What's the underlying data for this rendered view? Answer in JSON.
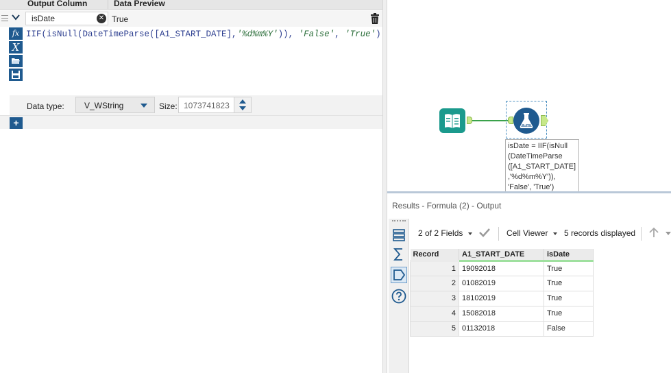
{
  "formula_panel": {
    "header": {
      "output_column": "Output Column",
      "data_preview": "Data Preview"
    },
    "field": {
      "name": "isDate",
      "preview": "True"
    },
    "expression": {
      "parts": [
        {
          "text": "IIF(isNull(DateTimeParse([A1_START_DATE],",
          "kind": "code"
        },
        {
          "text": "'%d%m%Y'",
          "kind": "string"
        },
        {
          "text": ")), ",
          "kind": "code"
        },
        {
          "text": "'False'",
          "kind": "string"
        },
        {
          "text": ", ",
          "kind": "code"
        },
        {
          "text": "'True'",
          "kind": "string"
        },
        {
          "text": ")",
          "kind": "code"
        }
      ]
    },
    "tools": {
      "fx": "fx",
      "variable": "X"
    },
    "data_type": {
      "label": "Data type:",
      "value": "V_WString"
    },
    "size": {
      "label": "Size:",
      "value": "1073741823"
    },
    "add_button": "+"
  },
  "canvas": {
    "annotation": "isDate = IIF(isNull\n(DateTimeParse\n([A1_START_DATE]\n,'%d%m%Y')),\n'False', 'True')",
    "connector_color": "#3aa24b"
  },
  "results": {
    "title": "Results - Formula (2) - Output",
    "toolbar": {
      "fields": "2 of 2 Fields",
      "cell_viewer": "Cell Viewer",
      "records": "5 records displayed"
    },
    "columns": [
      "Record",
      "A1_START_DATE",
      "isDate"
    ],
    "rows": [
      [
        "1",
        "19092018",
        "True"
      ],
      [
        "2",
        "01082019",
        "True"
      ],
      [
        "3",
        "18102019",
        "True"
      ],
      [
        "4",
        "15082018",
        "True"
      ],
      [
        "5",
        "01132018",
        "False"
      ]
    ]
  },
  "colors": {
    "accent": "#1f5a8f",
    "input_tool": "#1b9a8d",
    "anchor": "#c7e88a"
  }
}
